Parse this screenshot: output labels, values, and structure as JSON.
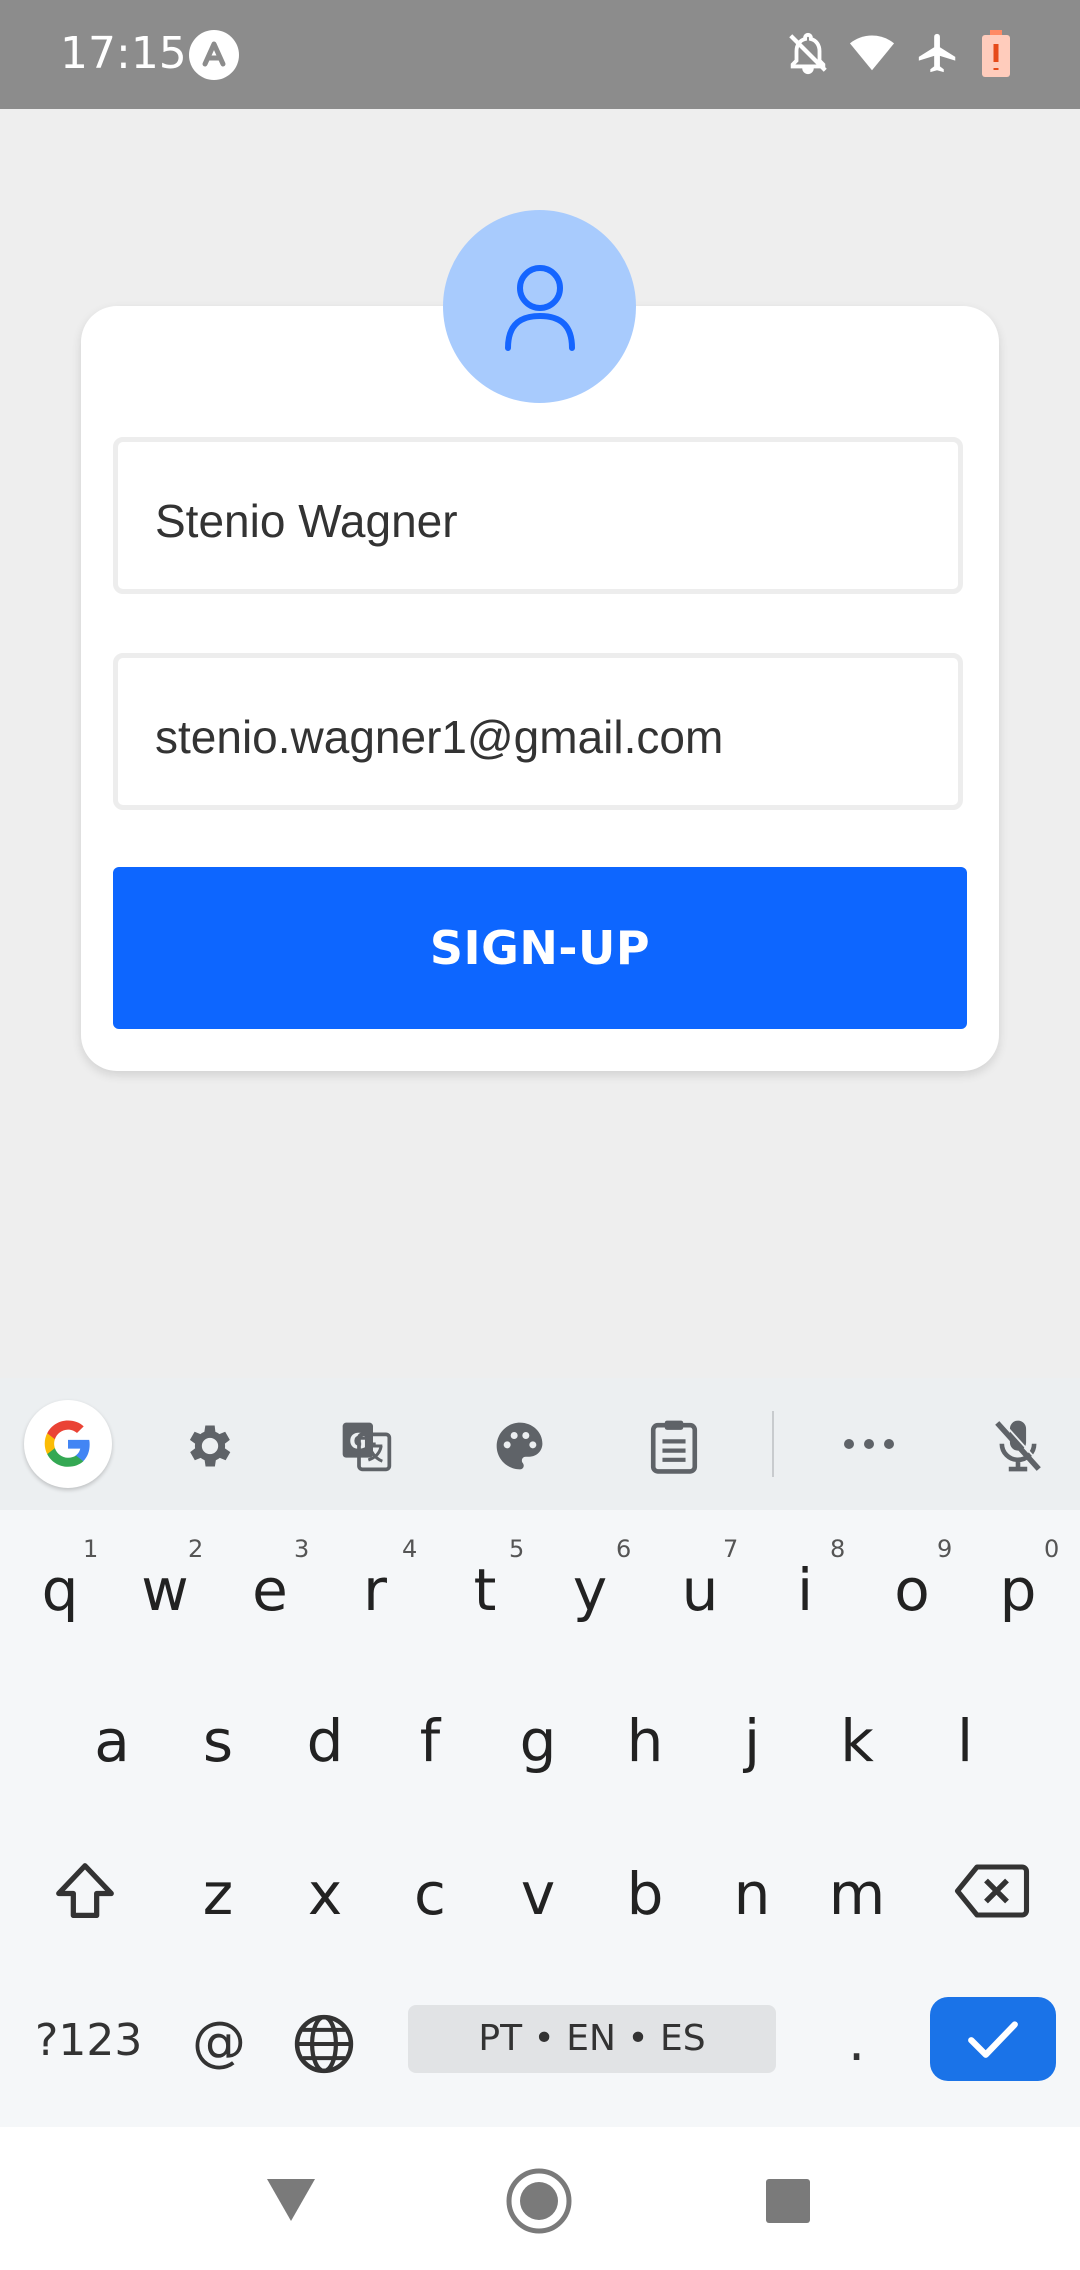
{
  "status_bar": {
    "time": "17:15",
    "icons": [
      "app-notification-icon",
      "notifications-off-icon",
      "wifi-icon",
      "airplane-mode-icon",
      "battery-low-icon"
    ]
  },
  "form": {
    "avatar_icon": "person-icon",
    "name_value": "Stenio Wagner",
    "email_value": "stenio.wagner1@gmail.com",
    "signup_label": "SIGN-UP"
  },
  "keyboard_toolbar": {
    "icons": [
      "google-g-icon",
      "settings-gear-icon",
      "translate-icon",
      "palette-icon",
      "clipboard-icon",
      "more-icon",
      "mic-off-icon"
    ]
  },
  "keyboard": {
    "row1": [
      "q",
      "w",
      "e",
      "r",
      "t",
      "y",
      "u",
      "i",
      "o",
      "p"
    ],
    "row1_hints": [
      "1",
      "2",
      "3",
      "4",
      "5",
      "6",
      "7",
      "8",
      "9",
      "0"
    ],
    "row2": [
      "a",
      "s",
      "d",
      "f",
      "g",
      "h",
      "j",
      "k",
      "l"
    ],
    "row3": [
      "z",
      "x",
      "c",
      "v",
      "b",
      "n",
      "m"
    ],
    "symbols_label": "?123",
    "at_label": "@",
    "space_label": "PT • EN • ES",
    "period_label": "."
  },
  "colors": {
    "accent": "#0d66ff",
    "avatar_bg": "#a8cbfd",
    "status_bar_bg": "#8c8c8c"
  }
}
